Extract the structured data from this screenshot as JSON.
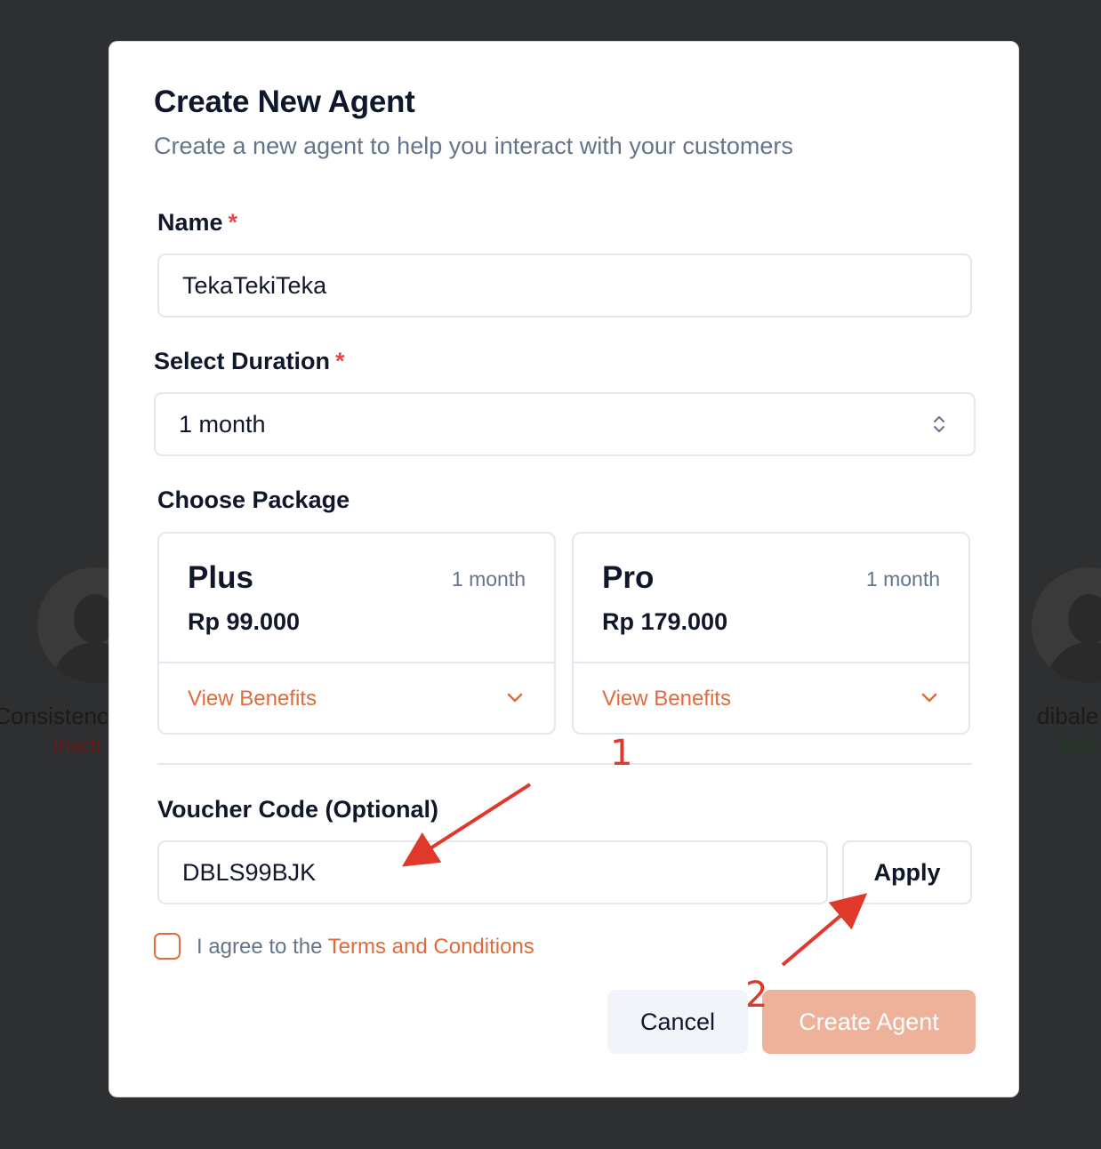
{
  "background": {
    "left_agent": {
      "name": "Consistenc",
      "status": "Inacti",
      "status_color": "#7f1d1d"
    },
    "right_agent": {
      "name": "dibale",
      "status": "Activ",
      "status_color": "#14532d"
    }
  },
  "modal": {
    "title": "Create New Agent",
    "subtitle": "Create a new agent to help you interact with your customers",
    "name_field": {
      "label": "Name",
      "required_mark": "*",
      "value": "TekaTekiTeka"
    },
    "duration_field": {
      "label": "Select Duration",
      "required_mark": "*",
      "value": "1 month"
    },
    "package_section": {
      "label": "Choose Package",
      "packages": [
        {
          "name": "Plus",
          "duration": "1 month",
          "price": "Rp 99.000",
          "benefits_label": "View Benefits"
        },
        {
          "name": "Pro",
          "duration": "1 month",
          "price": "Rp 179.000",
          "benefits_label": "View Benefits"
        }
      ]
    },
    "voucher": {
      "label": "Voucher Code (Optional)",
      "value": "DBLS99BJK",
      "apply_label": "Apply"
    },
    "terms": {
      "prefix": "I agree to the",
      "link": "Terms and Conditions",
      "checked": false
    },
    "actions": {
      "cancel_label": "Cancel",
      "create_label": "Create Agent"
    }
  },
  "annotations": {
    "marker_1": "1",
    "marker_2": "2",
    "color": "#e0382a"
  },
  "colors": {
    "accent": "#e06b3c",
    "accent_disabled": "#eeb29b",
    "overlay": "#2e2f31"
  }
}
